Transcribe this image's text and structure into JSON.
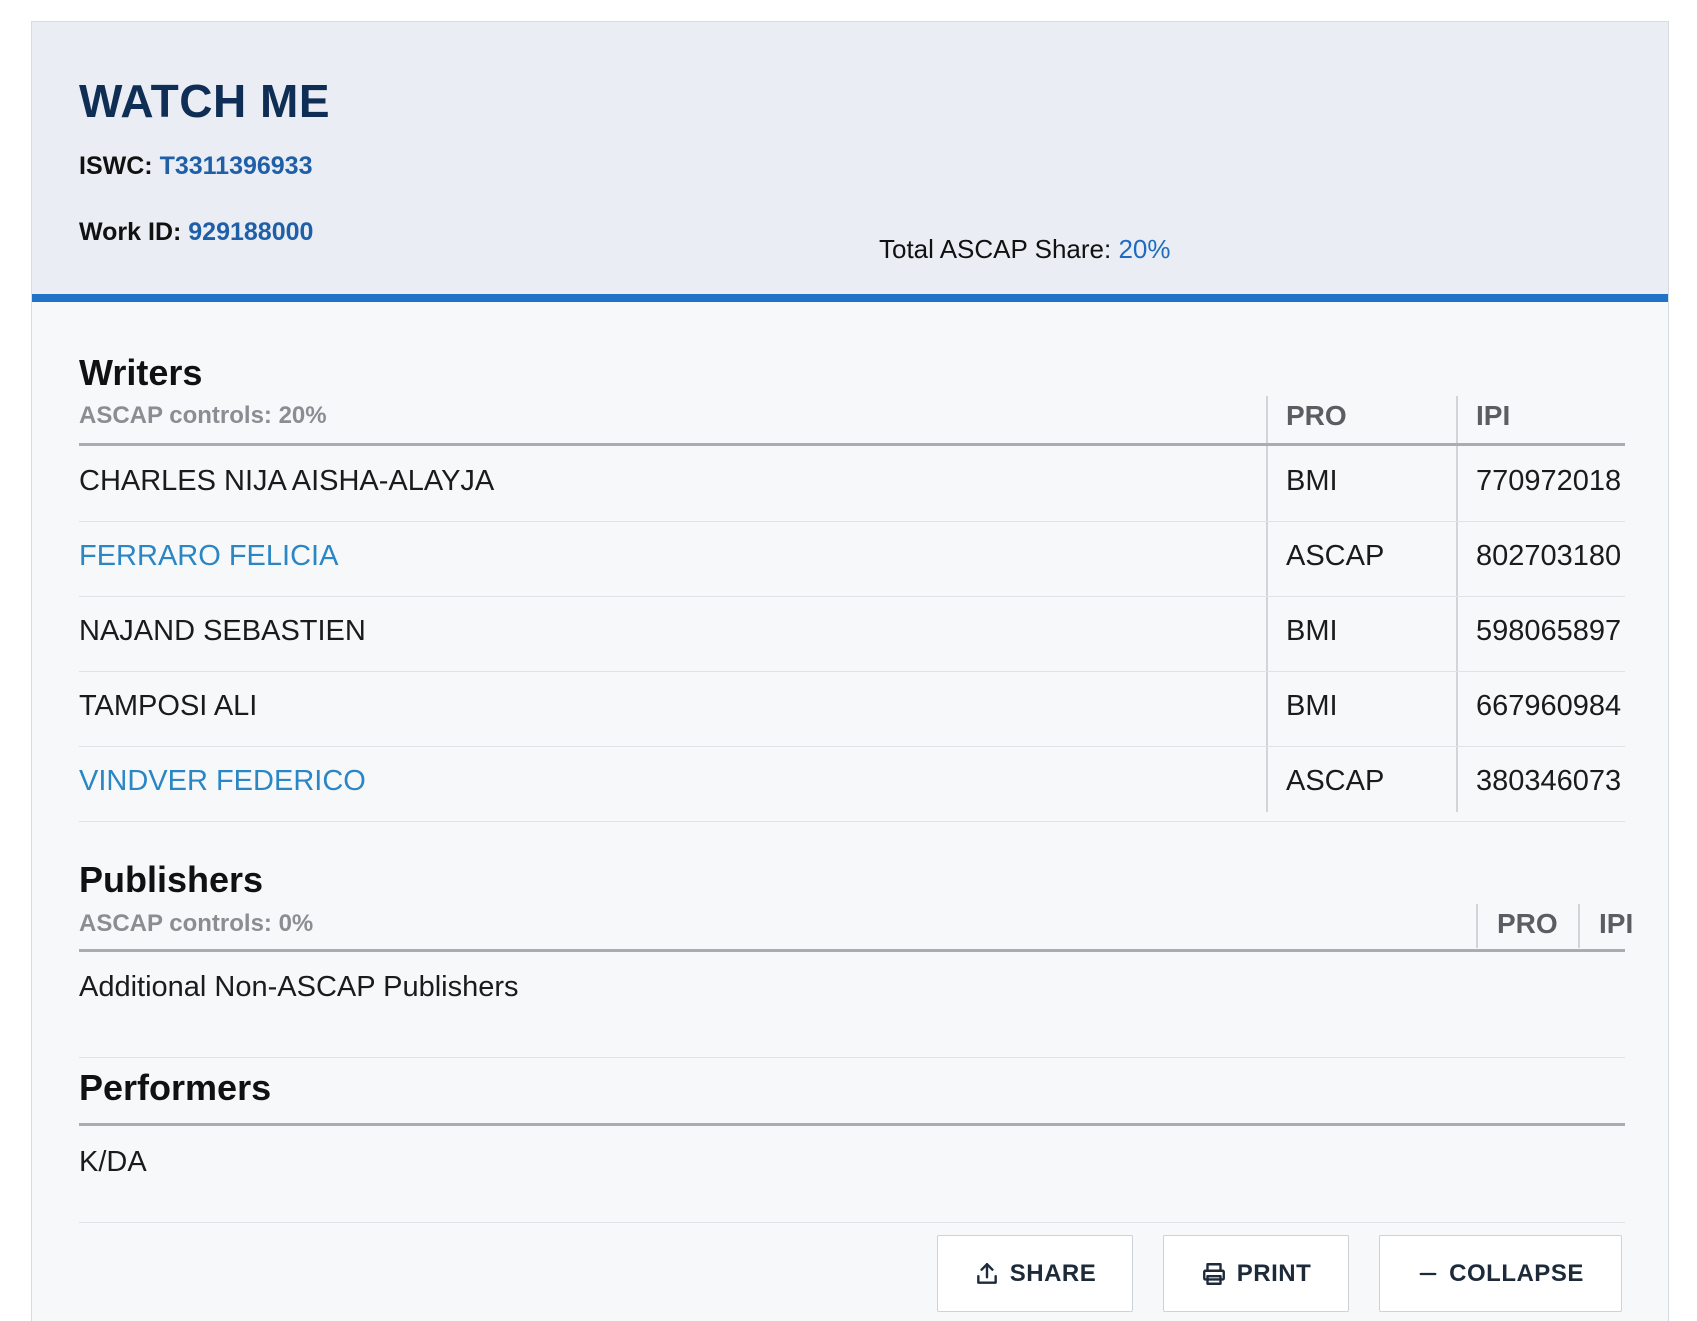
{
  "work": {
    "title": "WATCH ME",
    "iswc_label": "ISWC:",
    "iswc": "T3311396933",
    "work_id_label": "Work ID:",
    "work_id": "929188000",
    "total_share_label": "Total ASCAP Share:",
    "total_share": "20%"
  },
  "writers": {
    "title": "Writers",
    "controls": "ASCAP controls: 20%",
    "columns": [
      "PRO",
      "IPI"
    ],
    "rows": [
      {
        "name": "CHARLES NIJA AISHA-ALAYJA",
        "pro": "BMI",
        "ipi": "770972018"
      },
      {
        "name": "FERRARO FELICIA",
        "pro": "ASCAP",
        "ipi": "802703180"
      },
      {
        "name": "NAJAND SEBASTIEN",
        "pro": "BMI",
        "ipi": "598065897"
      },
      {
        "name": "TAMPOSI ALI",
        "pro": "BMI",
        "ipi": "667960984"
      },
      {
        "name": "VINDVER FEDERICO",
        "pro": "ASCAP",
        "ipi": "380346073"
      }
    ]
  },
  "publishers": {
    "title": "Publishers",
    "controls": "ASCAP controls: 0%",
    "columns": [
      "PRO",
      "IPI"
    ],
    "rows": [
      {
        "name": "Additional Non-ASCAP Publishers"
      }
    ]
  },
  "performers": {
    "title": "Performers",
    "rows": [
      {
        "name": "K/DA"
      }
    ]
  },
  "actions": {
    "share": "SHARE",
    "print": "PRINT",
    "collapse": "COLLAPSE"
  },
  "colors": {
    "accent": "#1f72c6",
    "link": "#2a86c5",
    "title": "#0f2e55"
  }
}
